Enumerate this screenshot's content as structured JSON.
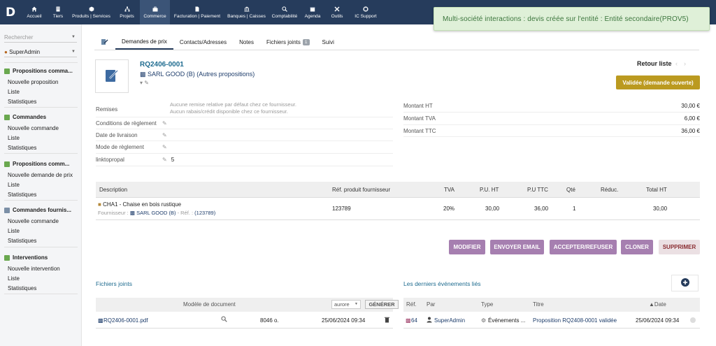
{
  "topbar": {
    "logo": "D",
    "menus": [
      {
        "label": "Accueil",
        "icon": "home-icon"
      },
      {
        "label": "Tiers",
        "icon": "building-icon"
      },
      {
        "label": "Produits | Services",
        "icon": "cube-icon"
      },
      {
        "label": "Projets",
        "icon": "sitemap-icon"
      },
      {
        "label": "Commerce",
        "icon": "briefcase-icon"
      },
      {
        "label": "Facturation | Paiement",
        "icon": "invoice-icon"
      },
      {
        "label": "Banques | Caisses",
        "icon": "bank-icon"
      },
      {
        "label": "Comptabilité",
        "icon": "search-dollar-icon"
      },
      {
        "label": "Agenda",
        "icon": "calendar-icon"
      },
      {
        "label": "Outils",
        "icon": "tools-icon"
      },
      {
        "label": "IC Support",
        "icon": "support-icon"
      }
    ]
  },
  "toast": "Multi-société interactions : devis créée sur l'entité : Entité secondaire(PROV5)",
  "sidebar": {
    "search_placeholder": "Rechercher",
    "user": "SuperAdmin",
    "groups": [
      {
        "title": "Propositions comma...",
        "items": [
          "Nouvelle proposition",
          "Liste",
          "Statistiques"
        ]
      },
      {
        "title": "Commandes",
        "items": [
          "Nouvelle commande",
          "Liste",
          "Statistiques"
        ]
      },
      {
        "title": "Propositions comm...",
        "items": [
          "Nouvelle demande de prix",
          "Liste",
          "Statistiques"
        ]
      },
      {
        "title": "Commandes fournis...",
        "items": [
          "Nouvelle commande",
          "Liste",
          "Statistiques"
        ]
      },
      {
        "title": "Interventions",
        "items": [
          "Nouvelle intervention",
          "Liste",
          "Statistiques"
        ]
      }
    ]
  },
  "tabs": [
    {
      "label": "Demandes de prix"
    },
    {
      "label": "Contacts/Adresses"
    },
    {
      "label": "Notes"
    },
    {
      "label": "Fichiers joints",
      "badge": "1"
    },
    {
      "label": "Suivi"
    }
  ],
  "header": {
    "ref": "RQ2406-0001",
    "supplier": "SARL GOOD (B) (Autres propositions)",
    "back": "Retour liste",
    "status": "Validée (demande ouverte)"
  },
  "fields": {
    "remises_label": "Remises",
    "remises_line1": "Aucune remise relative par défaut chez ce fournisseur.",
    "remises_line2": "Aucun rabais/crédit disponible chez ce fournisseur.",
    "conditions_label": "Conditions de règlement",
    "livraison_label": "Date de livraison",
    "mode_label": "Mode de règlement",
    "link_label": "linktopropal",
    "link_value": "5"
  },
  "amounts": {
    "ht_label": "Montant HT",
    "ht": "30,00 €",
    "tva_label": "Montant TVA",
    "tva": "6,00 €",
    "ttc_label": "Montant TTC",
    "ttc": "36,00 €"
  },
  "lines": {
    "headers": {
      "desc": "Description",
      "ref": "Réf. produit fournisseur",
      "tva": "TVA",
      "puht": "P.U. HT",
      "puttc": "P.U TTC",
      "qty": "Qté",
      "reduc": "Réduc.",
      "total": "Total HT"
    },
    "row": {
      "product": "CHA1 - Chaise en bois rustique",
      "supplier_label": "Fournisseur :",
      "supplier": "SARL GOOD (B)",
      "ref_label": "- Réf. :",
      "ref_paren": "(123789)",
      "ref": "123789",
      "tva": "20%",
      "puht": "30,00",
      "puttc": "36,00",
      "qty": "1",
      "total": "30,00"
    }
  },
  "buttons": {
    "modify": "MODIFIER",
    "email": "ENVOYER EMAIL",
    "accept": "ACCEPTER/REFUSER",
    "clone": "CLONER",
    "delete": "SUPPRIMER"
  },
  "files": {
    "title": "Fichiers joints",
    "model_label": "Modèle de document",
    "model_value": "aurore",
    "generate": "GÉNÉRER",
    "file": "RQ2406-0001.pdf",
    "size": "8046 o.",
    "date": "25/06/2024 09:34"
  },
  "events": {
    "title": "Les derniers événements liés",
    "headers": {
      "ref": "Réf.",
      "par": "Par",
      "type": "Type",
      "titre": "Titre",
      "date": "Date"
    },
    "row": {
      "ref": "64",
      "par": "SuperAdmin",
      "type": "Événements ...",
      "titre": "Proposition RQ2408-0001 validée",
      "date": "25/06/2024 09:34"
    }
  }
}
